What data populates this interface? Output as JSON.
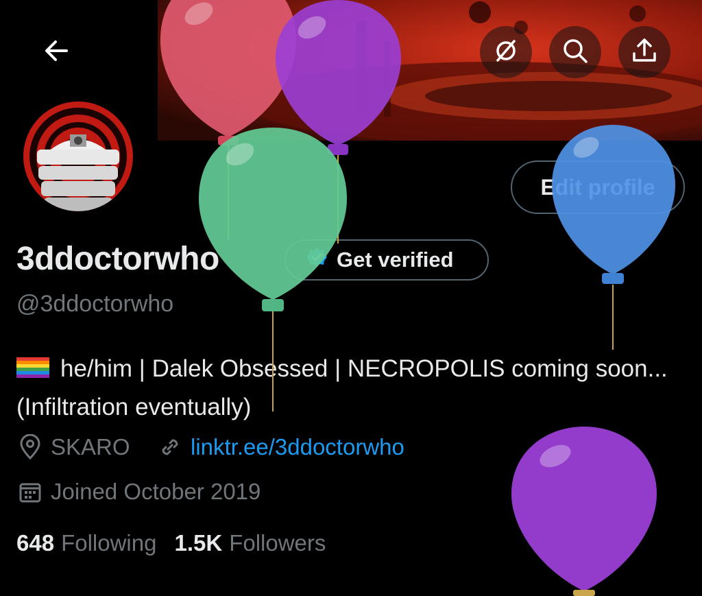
{
  "header": {
    "back_icon": "arrow-left-icon",
    "actions": [
      "hide-icon",
      "search-icon",
      "share-icon"
    ]
  },
  "profile": {
    "display_name": "3ddoctorwho",
    "handle": "@3ddoctorwho",
    "edit_label": "Edit profile",
    "verify_label": "Get verified",
    "bio": "he/him | Dalek Obsessed | NECROPOLIS coming soon... (Infiltration eventually)",
    "location": "SKARO",
    "link": "linktr.ee/3ddoctorwho",
    "joined": "Joined October 2019"
  },
  "stats": {
    "following_count": "648",
    "following_label": "Following",
    "followers_count": "1.5K",
    "followers_label": "Followers"
  },
  "colors": {
    "accent": "#1d9bf0",
    "muted": "#71767b",
    "text": "#e7e9ea",
    "balloon_red": "#e05a6f",
    "balloon_purple": "#9b3fd6",
    "balloon_green": "#62c995",
    "balloon_blue": "#4f93e6"
  }
}
